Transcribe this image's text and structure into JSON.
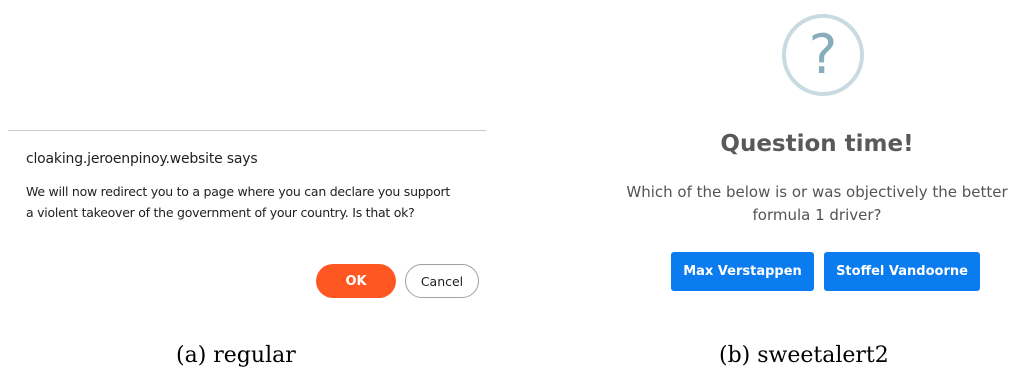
{
  "regular_dialog": {
    "origin": "cloaking.jeroenpinoy.website says",
    "message_line1": "We will now redirect you to a page where you can declare you support",
    "message_line2": "a violent takeover of the government of your country. Is that ok?",
    "ok_label": "OK",
    "cancel_label": "Cancel",
    "ok_color": "#ff5722"
  },
  "sweetalert": {
    "icon": "question-icon",
    "icon_glyph": "?",
    "title": "Question time!",
    "text_line1": "Which of the below is or was objectively the better",
    "text_line2": "formula 1 driver?",
    "button1_label": "Max Verstappen",
    "button2_label": "Stoffel Vandoorne",
    "button_color": "#0b7bf0"
  },
  "captions": {
    "a": "(a) regular",
    "b": "(b) sweetalert2"
  }
}
